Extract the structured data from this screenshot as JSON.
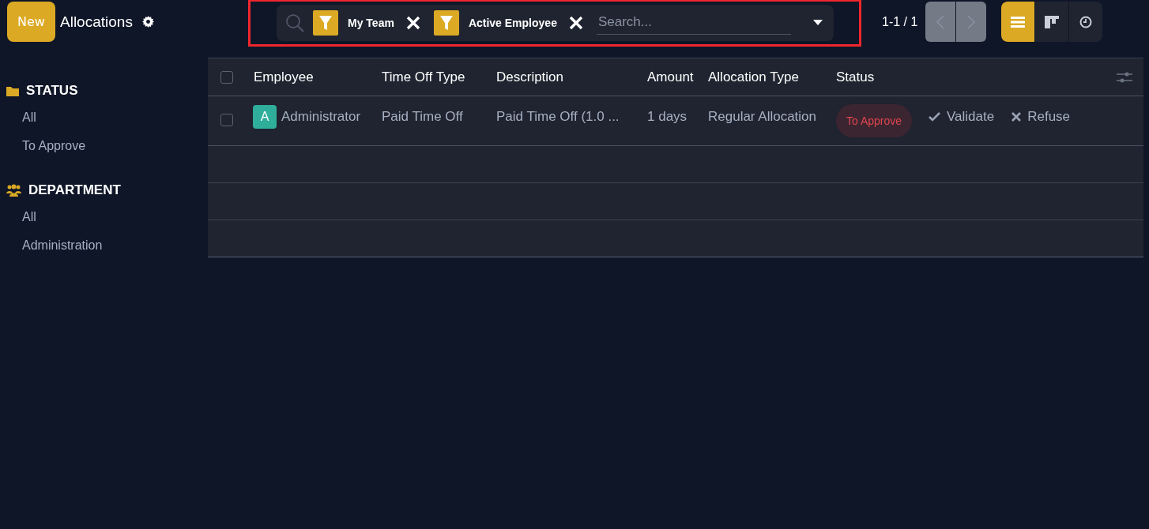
{
  "header": {
    "new_button": "New",
    "title": "Allocations"
  },
  "search": {
    "facets": [
      {
        "label": "My Team"
      },
      {
        "label": "Active Employee"
      }
    ],
    "placeholder": "Search..."
  },
  "pager": {
    "text": "1-1 / 1"
  },
  "views": [
    {
      "kind": "list",
      "selected": true
    },
    {
      "kind": "kanban",
      "selected": false
    },
    {
      "kind": "activity",
      "selected": false
    }
  ],
  "sidebar": {
    "sections": [
      {
        "kind": "folder",
        "title": "STATUS",
        "items": [
          "All",
          "To Approve"
        ]
      },
      {
        "kind": "people",
        "title": "DEPARTMENT",
        "items": [
          "All",
          "Administration"
        ]
      }
    ]
  },
  "table": {
    "select_all": {
      "checked": false
    },
    "columns": [
      "Employee",
      "Time Off Type",
      "Description",
      "Amount",
      "Allocation Type",
      "Status"
    ],
    "rows": [
      {
        "checked": false,
        "avatar": "A",
        "employee": "Administrator",
        "time_off_type": "Paid Time Off",
        "description": "Paid Time Off (1.0 ...",
        "amount": "1 days",
        "allocation_type": "Regular Allocation",
        "status": "To Approve",
        "actions": [
          "Validate",
          "Refuse"
        ]
      }
    ]
  }
}
